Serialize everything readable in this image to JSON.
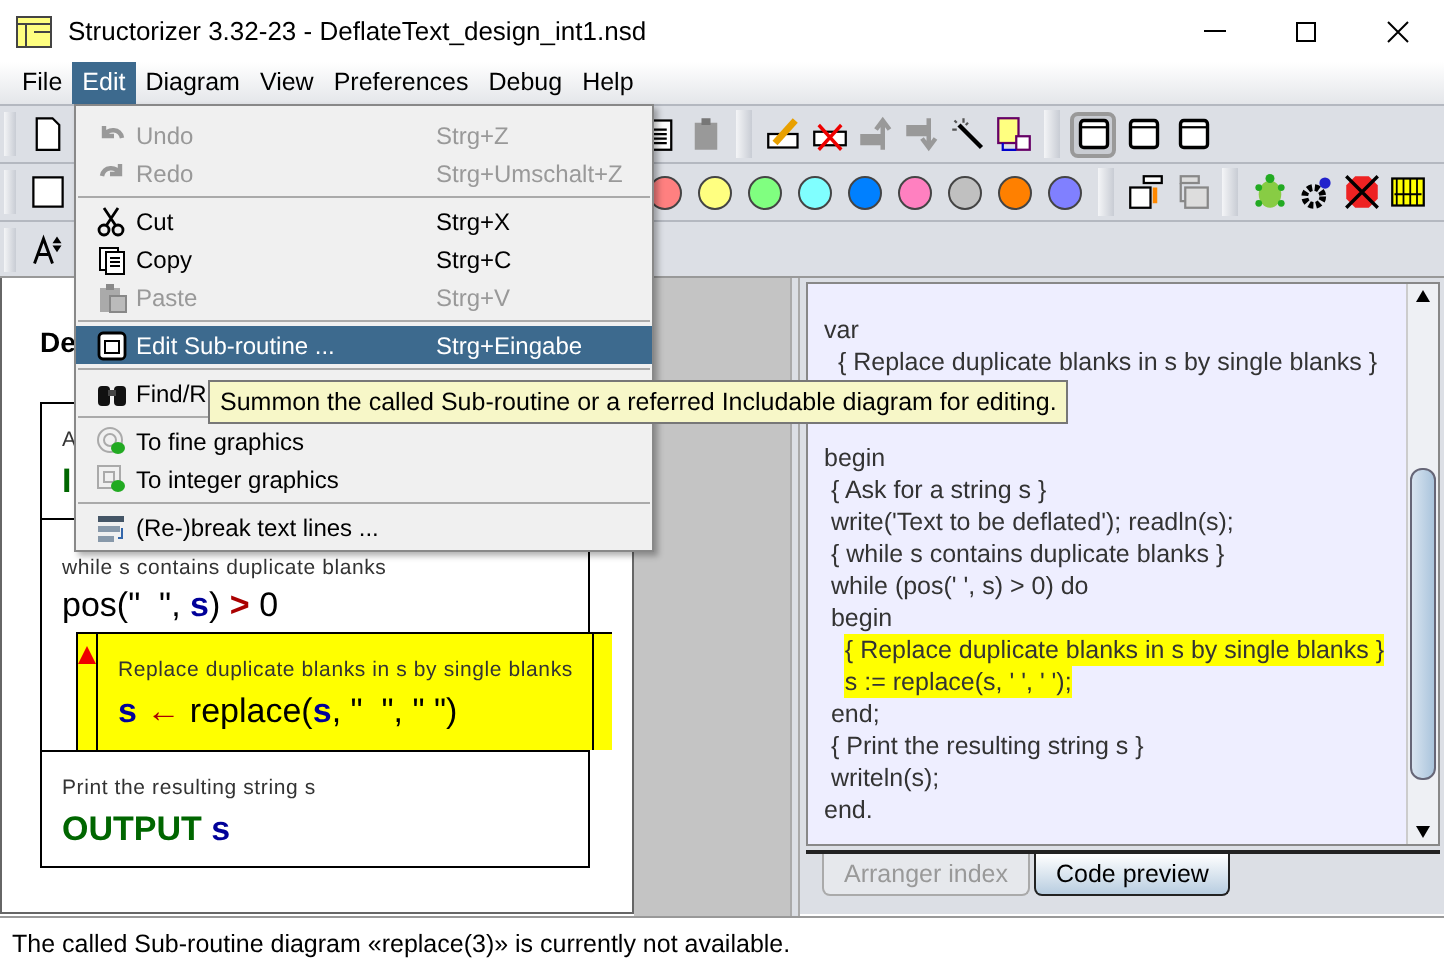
{
  "window": {
    "title": "Structorizer 3.32-23 - DeflateText_design_int1.nsd"
  },
  "menu_bar": [
    {
      "label": "File",
      "selected": false
    },
    {
      "label": "Edit",
      "selected": true
    },
    {
      "label": "Diagram",
      "selected": false
    },
    {
      "label": "View",
      "selected": false
    },
    {
      "label": "Preferences",
      "selected": false
    },
    {
      "label": "Debug",
      "selected": false
    },
    {
      "label": "Help",
      "selected": false
    }
  ],
  "toolbar": {
    "frame_toggles": [
      {
        "selected": true
      },
      {
        "selected": false
      },
      {
        "selected": false
      }
    ],
    "palette": [
      {
        "color": "#ff8080"
      },
      {
        "color": "#ffff80"
      },
      {
        "color": "#80ff80"
      },
      {
        "color": "#80ffff"
      },
      {
        "color": "#0080ff"
      },
      {
        "color": "#ff80c0"
      },
      {
        "color": "#c0c0c0"
      },
      {
        "color": "#ff8000"
      },
      {
        "color": "#8080ff"
      }
    ]
  },
  "edit_menu": [
    {
      "kind": "item",
      "label": "Undo",
      "shortcut": "Strg+Z",
      "disabled": true,
      "selected": false
    },
    {
      "kind": "item",
      "label": "Redo",
      "shortcut": "Strg+Umschalt+Z",
      "disabled": true,
      "selected": false
    },
    {
      "kind": "separator"
    },
    {
      "kind": "item",
      "label": "Cut",
      "shortcut": "Strg+X",
      "disabled": false,
      "selected": false
    },
    {
      "kind": "item",
      "label": "Copy",
      "shortcut": "Strg+C",
      "disabled": false,
      "selected": false
    },
    {
      "kind": "item",
      "label": "Paste",
      "shortcut": "Strg+V",
      "disabled": true,
      "selected": false
    },
    {
      "kind": "separator"
    },
    {
      "kind": "item",
      "label": "Edit Sub-routine ...",
      "shortcut": "Strg+Eingabe",
      "disabled": false,
      "selected": true
    },
    {
      "kind": "separator"
    },
    {
      "kind": "item",
      "label": "Find/R",
      "disabled": false,
      "selected": false
    },
    {
      "kind": "separator"
    },
    {
      "kind": "item",
      "label": "To fine graphics",
      "disabled": false,
      "selected": false
    },
    {
      "kind": "item",
      "label": "To integer graphics",
      "disabled": false,
      "selected": false
    },
    {
      "kind": "separator"
    },
    {
      "kind": "item",
      "label": "(Re-)break text lines ...",
      "disabled": false,
      "selected": false
    }
  ],
  "tooltip": "Summon the called Sub-routine or a referred Includable diagram for editing.",
  "diagram": {
    "title": "De",
    "elements": [
      {
        "kind": "instruction",
        "comment": "A",
        "tokens": [
          {
            "text": "I",
            "kind": "keyword"
          }
        ]
      },
      {
        "kind": "loop",
        "comment": "while s contains duplicate blanks",
        "tokens": [
          {
            "text": "pos(\"  \", ",
            "kind": "plain"
          },
          {
            "text": "s",
            "kind": "var"
          },
          {
            "text": ") ",
            "kind": "plain"
          },
          {
            "text": ">",
            "kind": "op"
          },
          {
            "text": " 0",
            "kind": "plain"
          }
        ],
        "children": [
          {
            "kind": "call",
            "comment": "Replace duplicate blanks in s by single blanks",
            "color": "#ffff00",
            "flagged": true,
            "tokens": [
              {
                "text": "s",
                "kind": "var"
              },
              {
                "text": " ← ",
                "kind": "op"
              },
              {
                "text": "replace(",
                "kind": "plain"
              },
              {
                "text": "s",
                "kind": "var"
              },
              {
                "text": ", \"  \", \" \")",
                "kind": "plain"
              }
            ]
          }
        ]
      },
      {
        "kind": "instruction",
        "comment": "Print the resulting string s",
        "tokens": [
          {
            "text": "OUTPUT ",
            "kind": "keyword"
          },
          {
            "text": "s",
            "kind": "var"
          }
        ]
      }
    ]
  },
  "code_preview": {
    "blocks": [
      [
        {
          "text": "var",
          "highlighted": false
        },
        {
          "text": "  { Replace duplicate blanks in s by single blanks }",
          "highlighted": false
        }
      ],
      [
        {
          "text": "begin",
          "highlighted": false
        },
        {
          "text": " { Ask for a string s }",
          "highlighted": false
        },
        {
          "text": " write('Text to be deflated'); readln(s);",
          "highlighted": false
        },
        {
          "text": " { while s contains duplicate blanks }",
          "highlighted": false
        },
        {
          "text": " while (pos(' ', s) > 0) do",
          "highlighted": false
        },
        {
          "text": " begin",
          "highlighted": false
        },
        {
          "text": "   { Replace duplicate blanks in s by single blanks }",
          "highlighted": true
        },
        {
          "text": "   s := replace(s, ' ', ' ');",
          "highlighted": true
        },
        {
          "text": " end;",
          "highlighted": false
        },
        {
          "text": " { Print the resulting string s }",
          "highlighted": false
        },
        {
          "text": " writeln(s);",
          "highlighted": false
        },
        {
          "text": "end.",
          "highlighted": false
        }
      ]
    ]
  },
  "tabs": [
    {
      "label": "Arranger index",
      "selected": false
    },
    {
      "label": "Code preview",
      "selected": true
    }
  ],
  "status_bar": "The called Sub-routine diagram «replace(3)» is currently not available."
}
